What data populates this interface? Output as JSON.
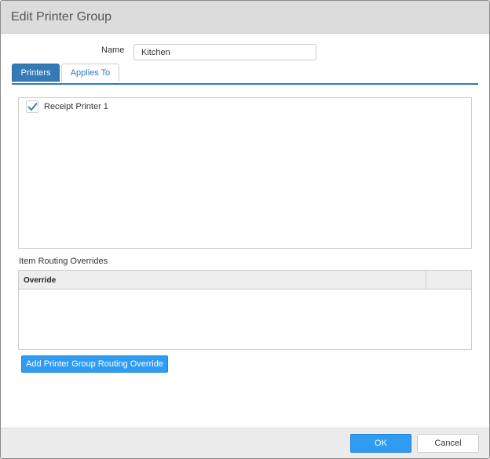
{
  "dialog": {
    "title": "Edit Printer Group"
  },
  "form": {
    "name_label": "Name",
    "name_value": "Kitchen"
  },
  "tabs": [
    {
      "label": "Printers",
      "active": true
    },
    {
      "label": "Applies To",
      "active": false
    }
  ],
  "printers": [
    {
      "label": "Receipt Printer 1",
      "checked": true
    }
  ],
  "overrides": {
    "section_label": "Item Routing Overrides",
    "columns": [
      "Override"
    ],
    "rows": [],
    "add_button_label": "Add Printer Group Routing Override"
  },
  "footer": {
    "ok_label": "OK",
    "cancel_label": "Cancel"
  },
  "colors": {
    "accent": "#337ab7",
    "button_primary": "#2f9cf2",
    "header_bg": "#dcdcdc",
    "footer_bg": "#ececec"
  }
}
